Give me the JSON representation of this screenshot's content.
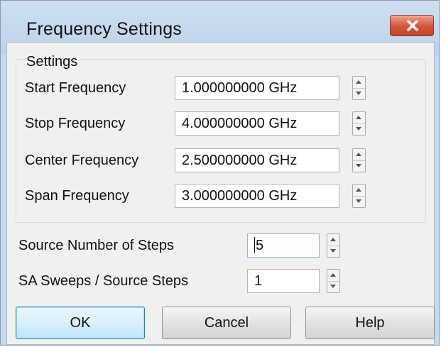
{
  "window": {
    "title": "Frequency Settings",
    "close_icon": "close-icon"
  },
  "settings_group": {
    "title": "Settings",
    "rows": [
      {
        "label": "Start Frequency",
        "value": "1.000000000 GHz"
      },
      {
        "label": "Stop Frequency",
        "value": "4.000000000 GHz"
      },
      {
        "label": "Center Frequency",
        "value": "2.500000000 GHz"
      },
      {
        "label": "Span Frequency",
        "value": "3.000000000 GHz"
      }
    ]
  },
  "source_steps": {
    "label": "Source Number of Steps",
    "value": "5"
  },
  "sa_sweeps": {
    "label": "SA Sweeps / Source Steps",
    "value": "1"
  },
  "buttons": {
    "ok": "OK",
    "cancel": "Cancel",
    "help": "Help"
  },
  "colors": {
    "title_bar": "#c6d9ee",
    "close_button": "#d2553c",
    "dialog_background": "#f0f0f0",
    "default_button": "#bee6fd"
  }
}
